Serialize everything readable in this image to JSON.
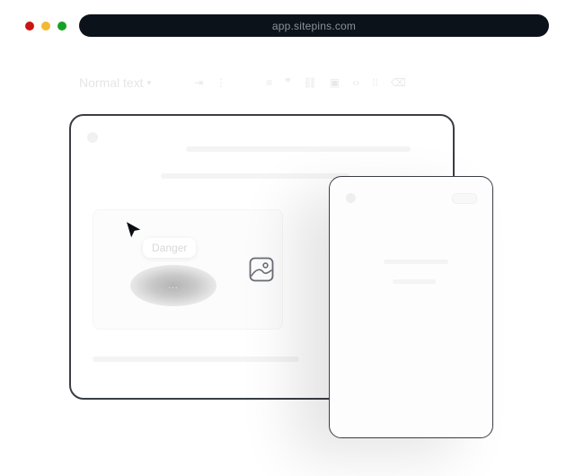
{
  "browser": {
    "url": "app.sitepins.com",
    "traffic_lights": {
      "close": "#cc1414",
      "minimize": "#f2b935",
      "maximize": "#17a025"
    }
  },
  "toolbar": {
    "text_style": "Normal text",
    "icons": [
      "chevron-down-icon",
      "indent-icon",
      "list-icon",
      "align-icon",
      "quote-icon",
      "link-icon",
      "image-icon",
      "code-icon",
      "columns-icon",
      "clear-format-icon"
    ]
  },
  "canvas": {
    "tooltip_label": "Danger",
    "button_label": "..."
  }
}
